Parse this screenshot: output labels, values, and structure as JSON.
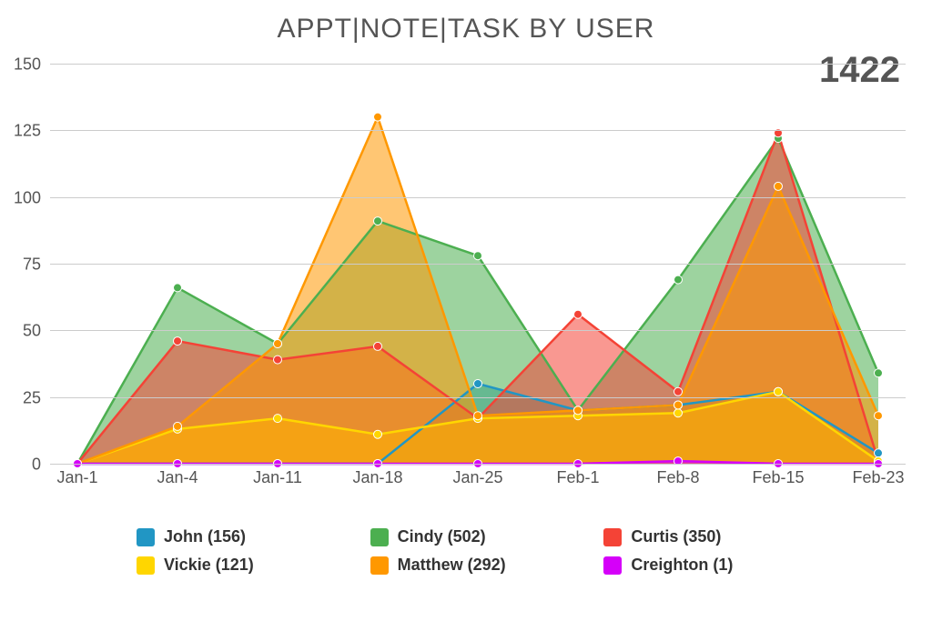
{
  "chart_data": {
    "type": "area",
    "title": "APPT|NOTE|TASK BY USER",
    "callout_total": "1422",
    "categories": [
      "Jan-1",
      "Jan-4",
      "Jan-11",
      "Jan-18",
      "Jan-25",
      "Feb-1",
      "Feb-8",
      "Feb-15",
      "Feb-23"
    ],
    "y_ticks": [
      0,
      25,
      50,
      75,
      100,
      125,
      150
    ],
    "ylim": [
      0,
      150
    ],
    "series": [
      {
        "name": "John",
        "total": 156,
        "color": "#2196c4",
        "fill": "rgba(33,150,196,0.55)",
        "values": [
          0,
          0,
          0,
          0,
          30,
          20,
          22,
          27,
          4
        ]
      },
      {
        "name": "Cindy",
        "total": 502,
        "color": "#4caf50",
        "fill": "rgba(76,175,80,0.55)",
        "values": [
          0,
          66,
          45,
          91,
          78,
          20,
          69,
          122,
          34
        ]
      },
      {
        "name": "Curtis",
        "total": 350,
        "color": "#f44336",
        "fill": "rgba(244,67,54,0.55)",
        "values": [
          0,
          46,
          39,
          44,
          17,
          56,
          27,
          124,
          1
        ]
      },
      {
        "name": "Vickie",
        "total": 121,
        "color": "#ffd600",
        "fill": "rgba(255,214,0,0.55)",
        "values": [
          0,
          13,
          17,
          11,
          17,
          18,
          19,
          27,
          1
        ]
      },
      {
        "name": "Matthew",
        "total": 292,
        "color": "#ff9800",
        "fill": "rgba(255,152,0,0.55)",
        "values": [
          0,
          14,
          45,
          130,
          18,
          20,
          22,
          104,
          18
        ]
      },
      {
        "name": "Creighton",
        "total": 1,
        "color": "#d500f9",
        "fill": "rgba(213,0,249,0.55)",
        "values": [
          0,
          0,
          0,
          0,
          0,
          0,
          1,
          0,
          0
        ]
      }
    ],
    "legend_columns": 3
  }
}
